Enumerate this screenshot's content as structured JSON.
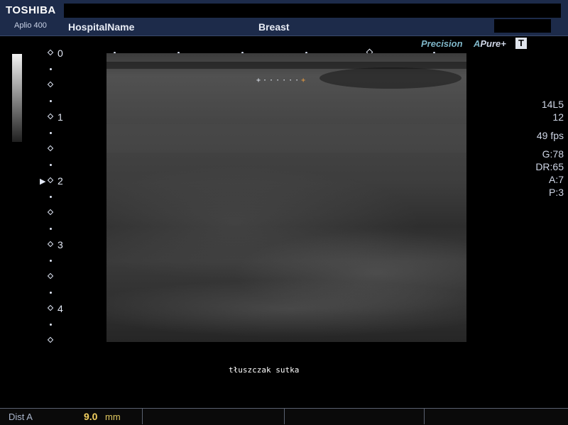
{
  "header": {
    "brand": "TOSHIBA",
    "model": "Aplio 400",
    "hospital": "HospitalName",
    "exam": "Breast"
  },
  "top_right": {
    "precision": "Precision",
    "apure_a": "A",
    "apure": "Pure+",
    "t_label": "T"
  },
  "depth_scale": {
    "labels": [
      "0",
      "1",
      "2",
      "3",
      "4"
    ],
    "focus_marker": "▶"
  },
  "caliper": {
    "start": "+",
    "dots": "······",
    "end": "+"
  },
  "params": {
    "probe": "14L5",
    "frequency": "12",
    "frame_rate": "49 fps",
    "gain": "G:78",
    "dynamic_range": "DR:65",
    "a": "A:7",
    "p": "P:3"
  },
  "annotation": "tłuszczak sutka",
  "measurement": {
    "label": "Dist  A",
    "value": "9.0",
    "unit": "mm"
  },
  "colors": {
    "header_bg": "#1d2b4a",
    "measure_value": "#f2d060",
    "accent_precision": "#7fb7c9"
  }
}
